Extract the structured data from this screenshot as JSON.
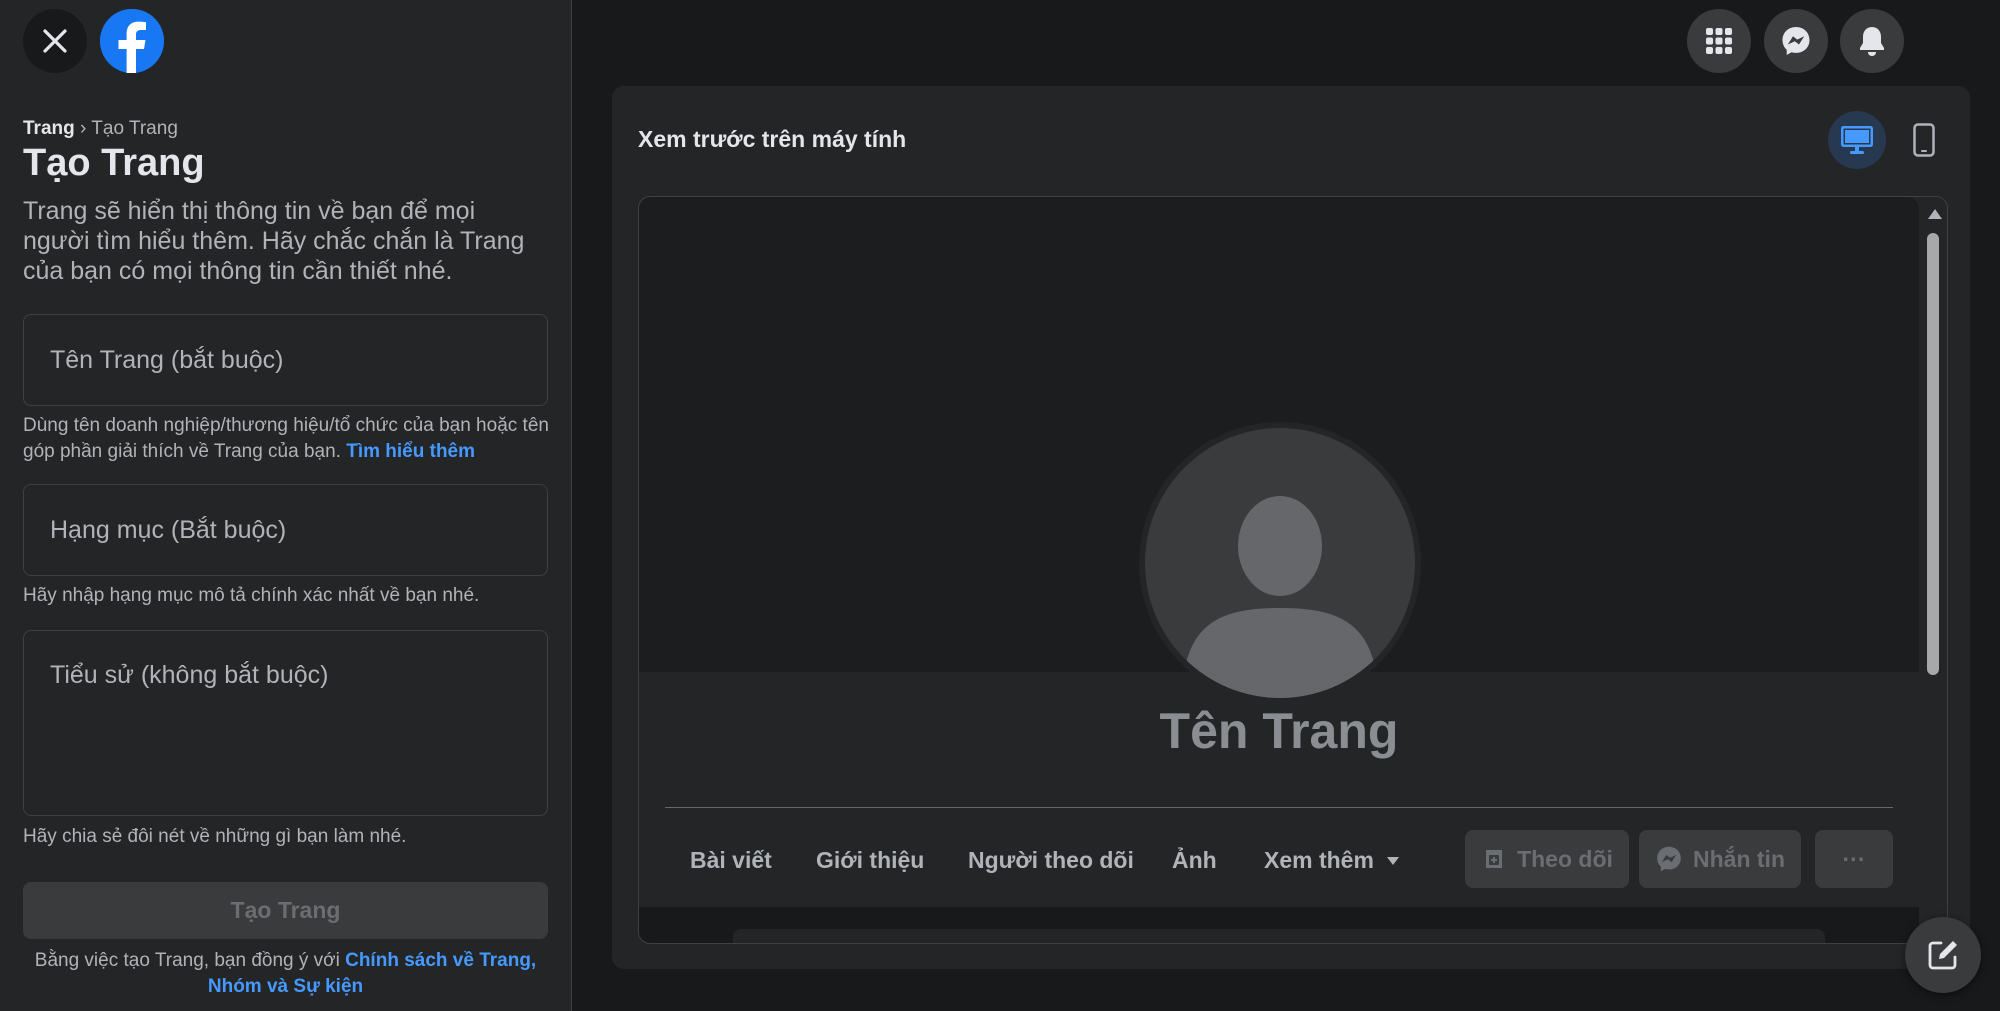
{
  "left_panel": {
    "breadcrumb": {
      "root": "Trang",
      "separator": "›",
      "current": "Tạo Trang"
    },
    "title": "Tạo Trang",
    "intro": "Trang sẽ hiển thị thông tin về bạn để mọi người tìm hiểu thêm. Hãy chắc chắn là Trang của bạn có mọi thông tin cần thiết nhé.",
    "name_field": {
      "placeholder": "Tên Trang (bắt buộc)",
      "value": "",
      "helper": "Dùng tên doanh nghiệp/thương hiệu/tổ chức của bạn hoặc tên góp phần giải thích về Trang của bạn.",
      "helper_link": "Tìm hiểu thêm"
    },
    "category_field": {
      "placeholder": "Hạng mục (Bắt buộc)",
      "value": "",
      "helper": "Hãy nhập hạng mục mô tả chính xác nhất về bạn nhé."
    },
    "bio_field": {
      "placeholder": "Tiểu sử (không bắt buộc)",
      "value": "",
      "helper": "Hãy chia sẻ đôi nét về những gì bạn làm nhé."
    },
    "create_button": "Tạo Trang",
    "terms_prefix": "Bằng việc tạo Trang, bạn đồng ý với",
    "terms_link": "Chính sách về Trang, Nhóm và Sự kiện"
  },
  "icons": {
    "close": "close-icon",
    "logo": "facebook-logo-icon",
    "apps": "grid-menu-icon",
    "messenger": "messenger-icon",
    "notifications": "bell-icon",
    "desktop": "desktop-monitor-icon",
    "mobile": "mobile-phone-icon",
    "compose": "compose-icon"
  },
  "preview": {
    "title": "Xem trước trên máy tính",
    "page_name": "Tên Trang",
    "tabs": [
      "Bài viết",
      "Giới thiệu",
      "Người theo dõi",
      "Ảnh",
      "Xem thêm"
    ],
    "follow_button": "Theo dõi",
    "message_button": "Nhắn tin",
    "more_button": "···"
  },
  "colors": {
    "background": "#18191a",
    "panel": "#242526",
    "accent": "#1877f2",
    "link": "#4599ff",
    "active_toggle": "#263951"
  }
}
